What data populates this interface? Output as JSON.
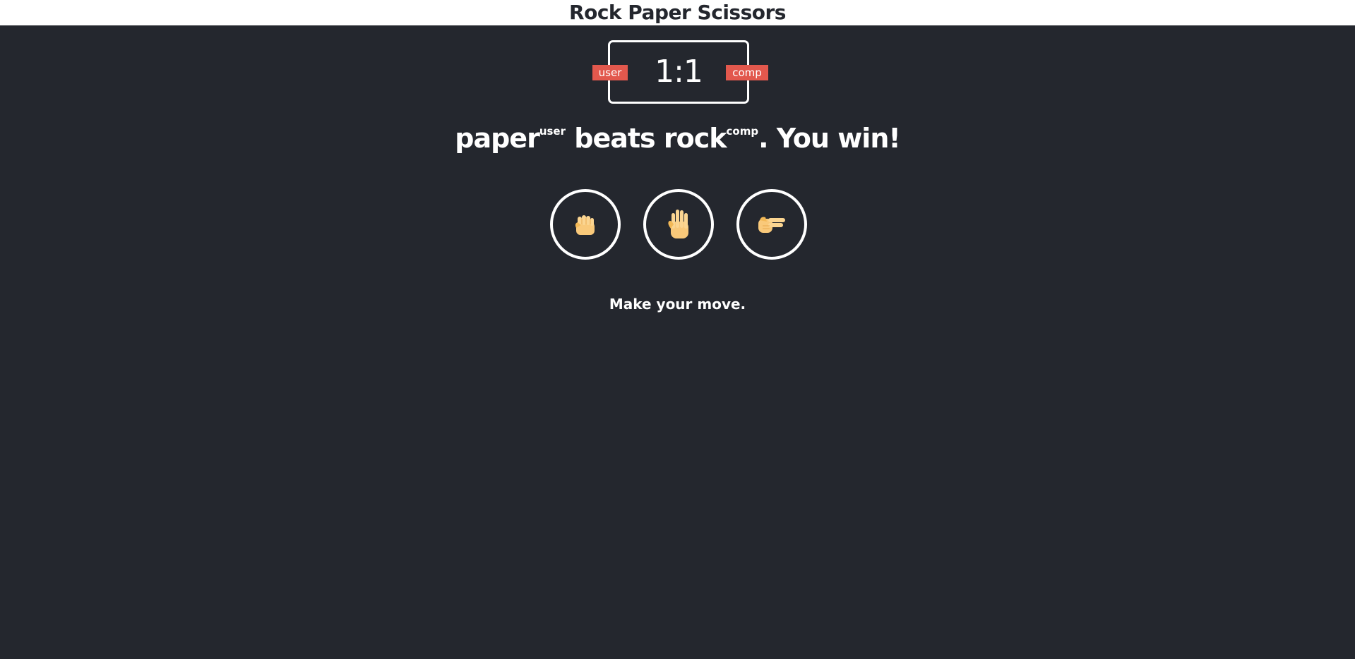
{
  "header": {
    "title": "Rock Paper Scissors"
  },
  "scoreboard": {
    "score": "1:1",
    "user_label": "user",
    "comp_label": "comp"
  },
  "result": {
    "user_choice": "paper",
    "user_tag": "user",
    "middle": " beats ",
    "comp_choice": "rock",
    "comp_tag": "comp",
    "outcome": ". You win!"
  },
  "choices": [
    {
      "name": "rock",
      "icon": "fist-icon"
    },
    {
      "name": "paper",
      "icon": "raised-hand-icon"
    },
    {
      "name": "scissors",
      "icon": "victory-hand-icon"
    }
  ],
  "prompt": "Make your move.",
  "colors": {
    "background": "#24272e",
    "header_background": "#ffffff",
    "badge": "#e2584d",
    "skin": "#f9c97a"
  }
}
